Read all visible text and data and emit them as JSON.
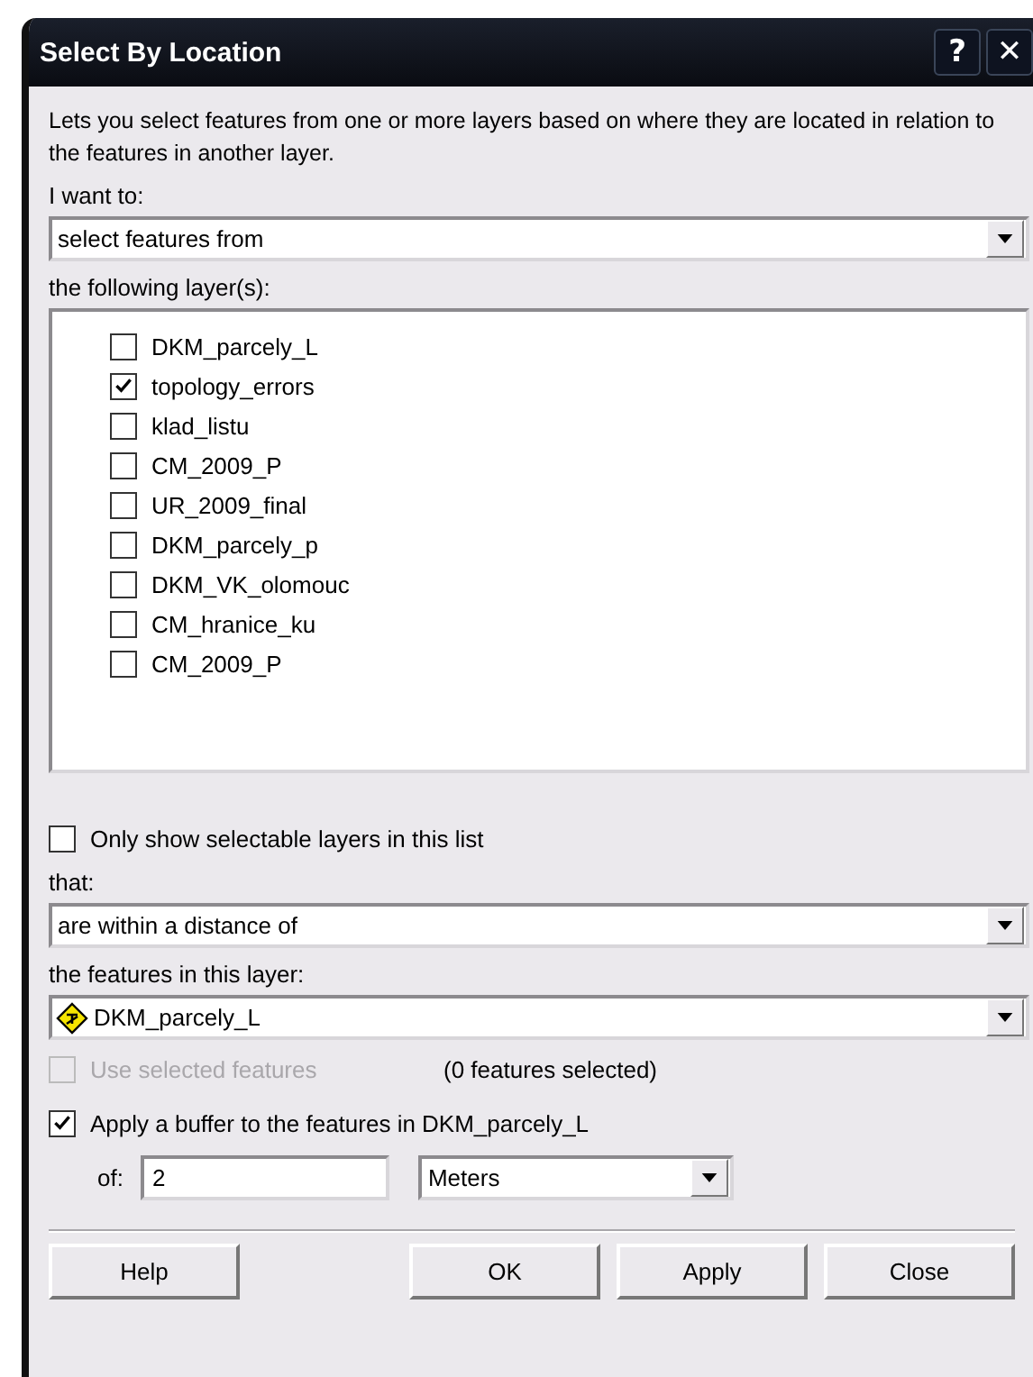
{
  "window": {
    "title": "Select By Location",
    "buttons": [
      "?",
      "✕"
    ]
  },
  "description": "Lets you select features from one or more layers based on where they are located in relation to the features in another layer.",
  "i_want_to": {
    "label": "I want to:",
    "value": "select features from"
  },
  "layers": {
    "label": "the following layer(s):",
    "items": [
      {
        "name": "DKM_parcely_L",
        "checked": false
      },
      {
        "name": "topology_errors",
        "checked": true
      },
      {
        "name": "klad_listu",
        "checked": false
      },
      {
        "name": "CM_2009_P",
        "checked": false
      },
      {
        "name": "UR_2009_final",
        "checked": false
      },
      {
        "name": "DKM_parcely_p",
        "checked": false
      },
      {
        "name": "DKM_VK_olomouc",
        "checked": false
      },
      {
        "name": "CM_hranice_ku",
        "checked": false
      },
      {
        "name": "CM_2009_P",
        "checked": false
      }
    ]
  },
  "only_selectable": {
    "label": "Only show selectable layers in this list",
    "checked": false
  },
  "that": {
    "label": "that:",
    "value": "are within a distance of"
  },
  "source_layer": {
    "label": "the features in this layer:",
    "value": "DKM_parcely_L"
  },
  "use_selected": {
    "label": "Use selected features",
    "checked": false,
    "disabled": true,
    "count": "(0 features selected)"
  },
  "buffer": {
    "label": "Apply a buffer to the features in DKM_parcely_L",
    "checked": true,
    "of_label": "of:",
    "distance": "2",
    "unit": "Meters"
  },
  "buttons": [
    "Help",
    "OK",
    "Apply",
    "Close"
  ]
}
